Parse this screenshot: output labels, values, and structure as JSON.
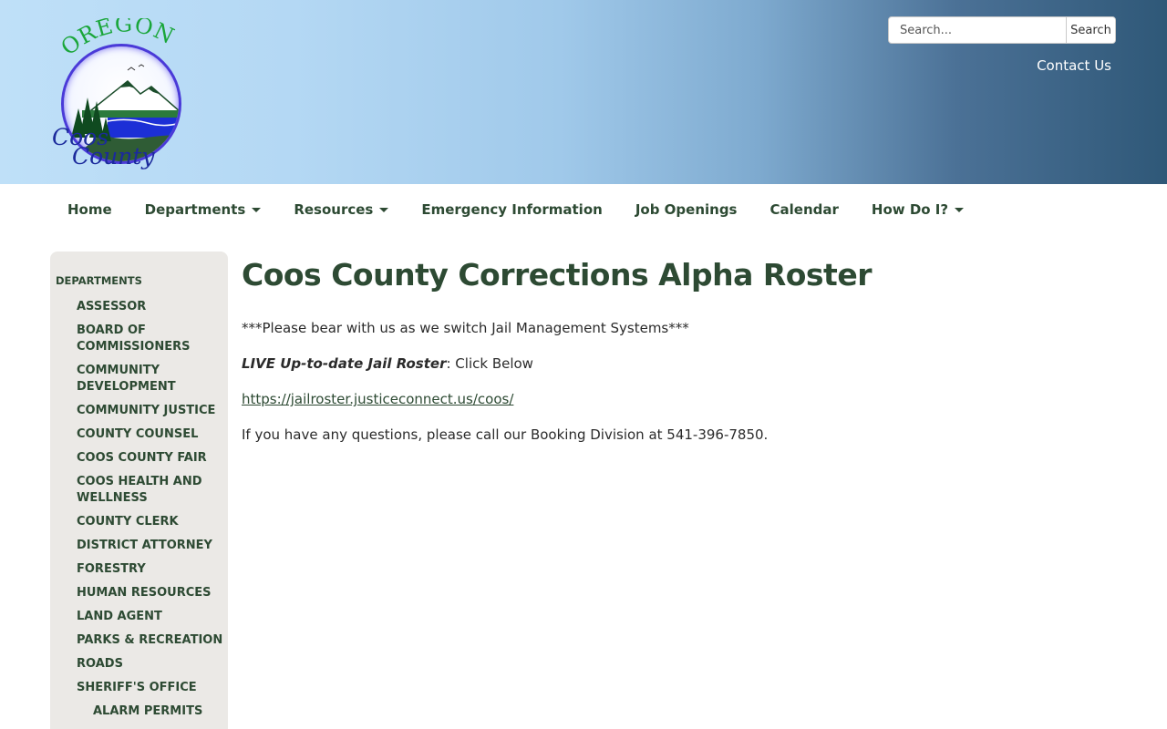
{
  "header": {
    "logo": {
      "top_text": "OREGON",
      "bottom_text_1": "Coos",
      "bottom_text_2": "County"
    },
    "search": {
      "placeholder": "Search...",
      "button_label": "Search"
    },
    "contact_label": "Contact Us"
  },
  "nav": {
    "items": [
      {
        "label": "Home",
        "dropdown": false
      },
      {
        "label": "Departments",
        "dropdown": true
      },
      {
        "label": "Resources",
        "dropdown": true
      },
      {
        "label": "Emergency Information",
        "dropdown": false
      },
      {
        "label": "Job Openings",
        "dropdown": false
      },
      {
        "label": "Calendar",
        "dropdown": false
      },
      {
        "label": "How Do I?",
        "dropdown": true
      }
    ]
  },
  "sidebar": {
    "heading": "DEPARTMENTS",
    "items": [
      {
        "label": "ASSESSOR"
      },
      {
        "label": "BOARD OF COMMISSIONERS"
      },
      {
        "label": "COMMUNITY DEVELOPMENT"
      },
      {
        "label": "COMMUNITY JUSTICE"
      },
      {
        "label": "COUNTY COUNSEL"
      },
      {
        "label": "COOS COUNTY FAIR"
      },
      {
        "label": "COOS HEALTH AND WELLNESS"
      },
      {
        "label": "COUNTY CLERK"
      },
      {
        "label": "DISTRICT ATTORNEY"
      },
      {
        "label": "FORESTRY"
      },
      {
        "label": "HUMAN RESOURCES"
      },
      {
        "label": "LAND AGENT"
      },
      {
        "label": "PARKS & RECREATION"
      },
      {
        "label": "ROADS"
      },
      {
        "label": "SHERIFF'S OFFICE"
      },
      {
        "label": "ALARM PERMITS",
        "sub": true
      }
    ]
  },
  "main": {
    "title": "Coos County Corrections Alpha Roster",
    "notice": "***Please bear with us as we switch Jail Management Systems***",
    "live_label": "LIVE Up-to-date Jail Roster",
    "live_suffix": ": Click Below",
    "roster_link": "https://jailroster.justiceconnect.us/coos/",
    "contact_text": "If you have any questions, please call our Booking Division at 541-396-7850."
  },
  "colors": {
    "brand_green": "#2d4a33",
    "header_gradient_start": "#bfe0f8",
    "header_gradient_end": "#2f5878",
    "sidebar_bg": "#ebe9e6",
    "logo_blue": "#1b2a9c",
    "logo_green": "#1aa63a"
  },
  "icons": {
    "dropdown": "caret-down-icon"
  }
}
